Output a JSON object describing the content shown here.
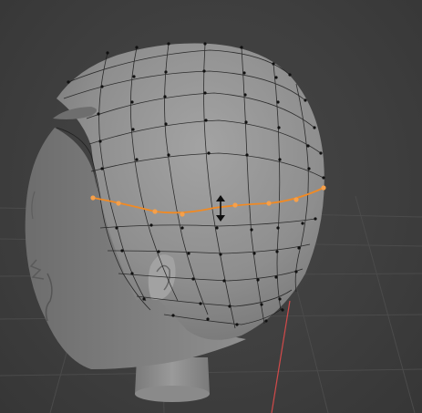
{
  "viewport": {
    "colors": {
      "background": "#3f3f3f",
      "grid": "#4a4a4a",
      "mesh": "#8c8c8c",
      "wire": "#101010",
      "selected": "#f08a24",
      "axis_x": "#d24a4a"
    },
    "icons": {
      "move_gizmo": "up-down-arrow-icon"
    }
  }
}
